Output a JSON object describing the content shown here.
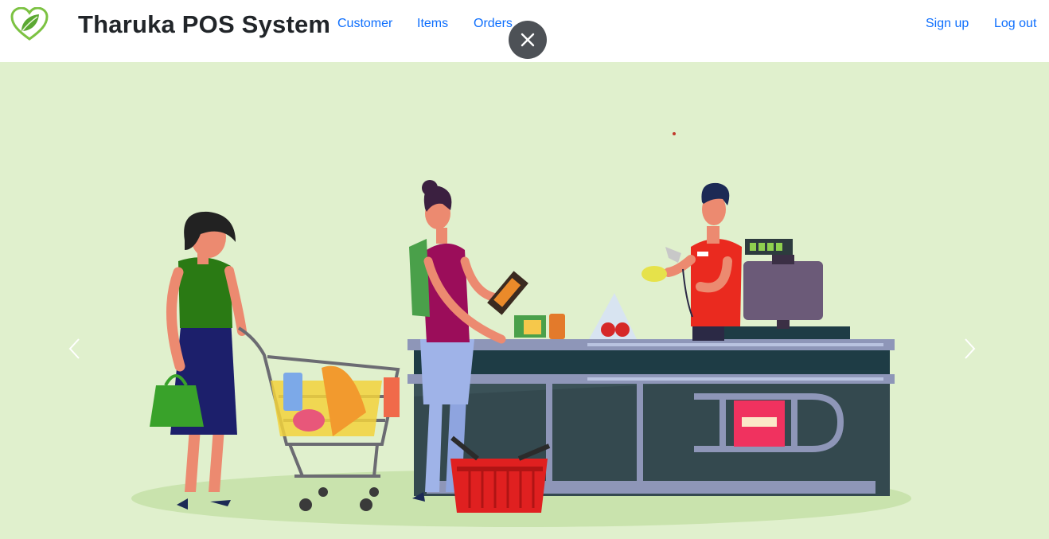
{
  "navbar": {
    "brand": "Tharuka POS System",
    "logo_icon": "leaf-heart-icon",
    "links": [
      {
        "label": "Customer"
      },
      {
        "label": "Items"
      },
      {
        "label": "Orders"
      }
    ],
    "right_links": [
      {
        "label": "Sign up"
      },
      {
        "label": "Log out"
      }
    ]
  },
  "overlay": {
    "close_icon": "close-icon"
  },
  "carousel": {
    "prev_icon": "chevron-left-icon",
    "next_icon": "chevron-right-icon",
    "slide_image": "supermarket-checkout-illustration"
  },
  "colors": {
    "accent": "#0d6efd",
    "hero_bg": "#e0f0cd",
    "close_bg": "#4d5156"
  }
}
